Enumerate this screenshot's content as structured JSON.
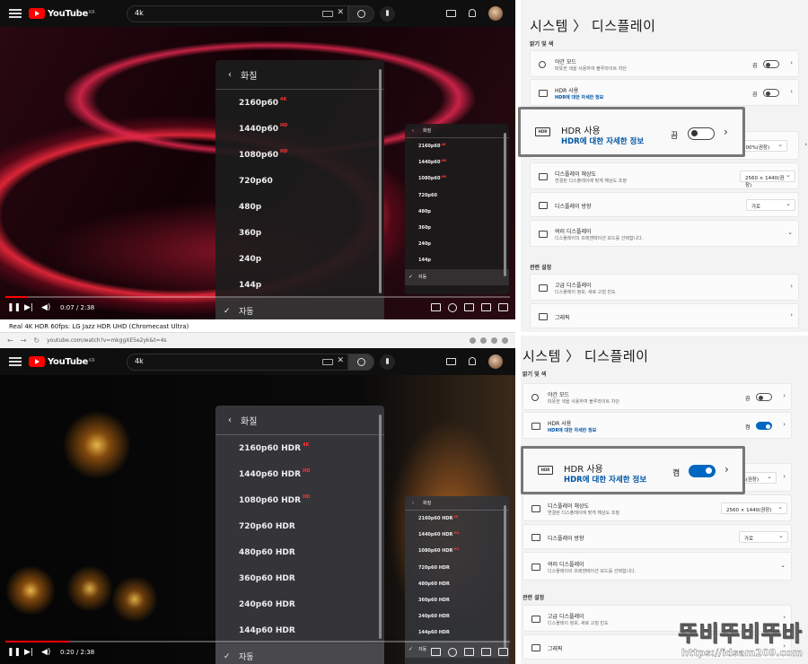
{
  "youtube": {
    "search_query": "4k",
    "logo_text": "YouTube",
    "logo_region": "KR"
  },
  "top_player": {
    "time": "0:07 / 2:38",
    "progress_fraction": 0.044,
    "big_menu": {
      "title": "화질",
      "items": [
        {
          "label": "2160p60",
          "badge": "4K",
          "selected": false
        },
        {
          "label": "1440p60",
          "badge": "HD",
          "selected": false
        },
        {
          "label": "1080p60",
          "badge": "HD",
          "selected": false
        },
        {
          "label": "720p60",
          "badge": "",
          "selected": false
        },
        {
          "label": "480p",
          "badge": "",
          "selected": false
        },
        {
          "label": "360p",
          "badge": "",
          "selected": false
        },
        {
          "label": "240p",
          "badge": "",
          "selected": false
        },
        {
          "label": "144p",
          "badge": "",
          "selected": false
        },
        {
          "label": "자동",
          "badge": "",
          "selected": true
        }
      ]
    },
    "small_menu": {
      "title": "화질",
      "items": [
        {
          "label": "2160p60",
          "badge": "4K",
          "selected": false
        },
        {
          "label": "1440p60",
          "badge": "HD",
          "selected": false
        },
        {
          "label": "1080p60",
          "badge": "HD",
          "selected": false
        },
        {
          "label": "720p60",
          "badge": "",
          "selected": false
        },
        {
          "label": "480p",
          "badge": "",
          "selected": false
        },
        {
          "label": "360p",
          "badge": "",
          "selected": false
        },
        {
          "label": "240p",
          "badge": "",
          "selected": false
        },
        {
          "label": "144p",
          "badge": "",
          "selected": false
        },
        {
          "label": "자동",
          "badge": "",
          "selected": true
        }
      ]
    }
  },
  "caption_strip": "Real 4K HDR 60fps: LG Jazz HDR UHD (Chromecast Ultra)",
  "browser": {
    "url": "youtube.com/watch?v=mkggXE5e2yk&t=4s"
  },
  "bottom_player": {
    "time": "0:20 / 2:38",
    "progress_fraction": 0.127,
    "big_menu": {
      "title": "화질",
      "items": [
        {
          "label": "2160p60 HDR",
          "badge": "4K",
          "selected": false
        },
        {
          "label": "1440p60 HDR",
          "badge": "HD",
          "selected": false
        },
        {
          "label": "1080p60 HDR",
          "badge": "HD",
          "selected": false
        },
        {
          "label": "720p60 HDR",
          "badge": "",
          "selected": false
        },
        {
          "label": "480p60 HDR",
          "badge": "",
          "selected": false
        },
        {
          "label": "360p60 HDR",
          "badge": "",
          "selected": false
        },
        {
          "label": "240p60 HDR",
          "badge": "",
          "selected": false
        },
        {
          "label": "144p60 HDR",
          "badge": "",
          "selected": false
        },
        {
          "label": "자동",
          "badge": "",
          "selected": true
        }
      ]
    },
    "small_menu": {
      "title": "화질",
      "items": [
        {
          "label": "2160p60 HDR",
          "badge": "4K",
          "selected": false
        },
        {
          "label": "1440p60 HDR",
          "badge": "HD",
          "selected": false
        },
        {
          "label": "1080p60 HDR",
          "badge": "HD",
          "selected": false
        },
        {
          "label": "720p60 HDR",
          "badge": "",
          "selected": false
        },
        {
          "label": "480p60 HDR",
          "badge": "",
          "selected": false
        },
        {
          "label": "360p60 HDR",
          "badge": "",
          "selected": false
        },
        {
          "label": "240p60 HDR",
          "badge": "",
          "selected": false
        },
        {
          "label": "144p60 HDR",
          "badge": "",
          "selected": false
        },
        {
          "label": "자동",
          "badge": "",
          "selected": true
        }
      ]
    }
  },
  "settings_top": {
    "title": "시스템  〉 디스플레이",
    "section_brightness": "밝기 및 색",
    "night_mode": {
      "title": "야간 모드",
      "desc": "따뜻한 색을 사용하여 블루라이트 차단",
      "state": "끔"
    },
    "hdr": {
      "title": "HDR 사용",
      "link": "HDR에 대한 자세한 정보",
      "state": "끔",
      "on": false
    },
    "scale_value": "100%(권장)",
    "resolution": {
      "title": "디스플레이 해상도",
      "desc": "연결된 디스플레이에 맞게 해상도 조정",
      "value": "2560 × 1440(권장)"
    },
    "orientation": {
      "title": "디스플레이 방향",
      "value": "가로"
    },
    "multi": {
      "title": "여러 디스플레이",
      "desc": "디스플레이의 프레젠테이션 모드를 선택합니다."
    },
    "section_related": "관련 설정",
    "advanced": {
      "title": "고급 디스플레이",
      "desc": "디스플레이 정보, 새로 고침 빈도"
    },
    "graphics": {
      "title": "그래픽"
    }
  },
  "settings_bottom": {
    "title": "시스템  〉 디스플레이",
    "section_brightness": "밝기 및 색",
    "night_mode": {
      "title": "야간 모드",
      "desc": "따뜻한 색을 사용하여 블루라이트 차단",
      "state": "끔"
    },
    "hdr": {
      "title": "HDR 사용",
      "link": "HDR에 대한 자세한 정보",
      "state": "켬",
      "on": true
    },
    "scale_value": "100%(권장)",
    "resolution": {
      "title": "디스플레이 해상도",
      "desc": "연결된 디스플레이에 맞게 해상도 조정",
      "value": "2560 × 1440(권장)"
    },
    "orientation": {
      "title": "디스플레이 방향",
      "value": "가로"
    },
    "multi": {
      "title": "여러 디스플레이",
      "desc": "디스플레이의 프레젠테이션 모드를 선택합니다."
    },
    "section_related": "관련 설정",
    "advanced": {
      "title": "고급 디스플레이",
      "desc": "디스플레이 정보, 새로 고침 빈도"
    },
    "graphics": {
      "title": "그래픽"
    }
  },
  "watermark": {
    "main": "뚜비뚜비뚜바",
    "url": "https://idsam209.com"
  }
}
